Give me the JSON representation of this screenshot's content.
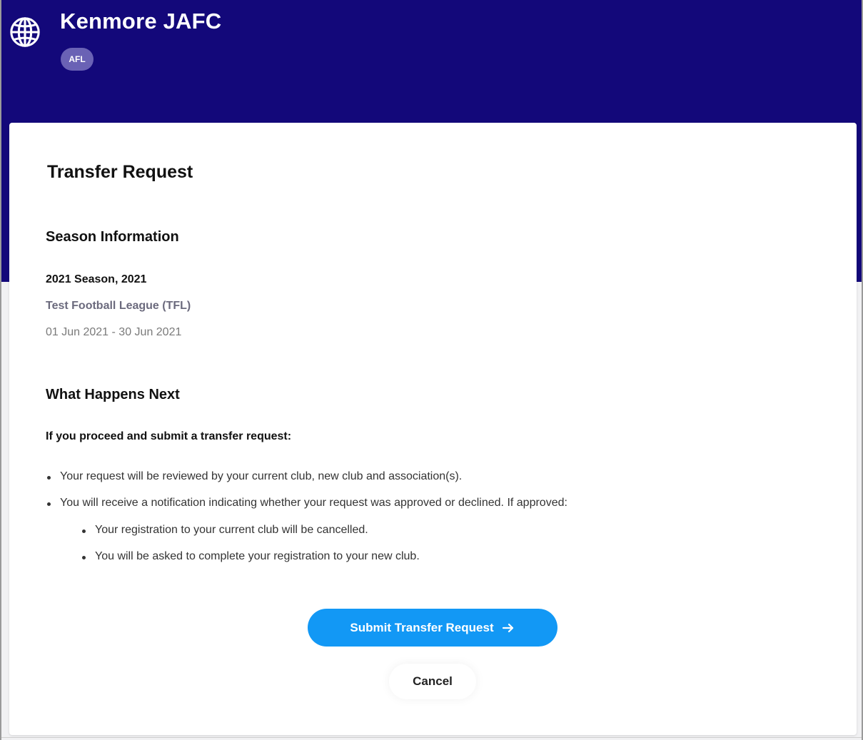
{
  "header": {
    "club_name": "Kenmore JAFC",
    "sport_badge": "AFL",
    "icon": "globe-icon",
    "background_color": "#13087a"
  },
  "card": {
    "title": "Transfer Request"
  },
  "season_info": {
    "heading": "Season Information",
    "season": "2021 Season, 2021",
    "league": "Test Football League (TFL)",
    "dates": "01 Jun 2021 - 30 Jun 2021"
  },
  "next_steps": {
    "heading": "What Happens Next",
    "intro": "If you proceed and submit a transfer request:",
    "bullets": [
      "Your request will be reviewed by your current club, new club and association(s).",
      "You will receive a notification indicating whether your request was approved or declined. If approved:"
    ],
    "sub_bullets": [
      "Your registration to your current club will be cancelled.",
      "You will be asked to complete your registration to your new club."
    ]
  },
  "actions": {
    "submit_label": "Submit Transfer Request",
    "submit_icon": "arrow-right-icon",
    "cancel_label": "Cancel",
    "accent_color": "#1298f5"
  }
}
